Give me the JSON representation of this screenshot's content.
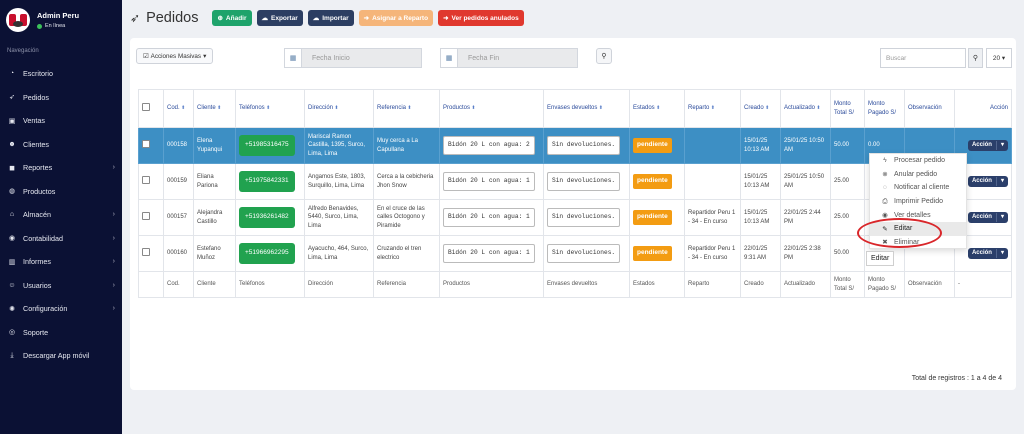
{
  "sidebar": {
    "user": "Admin Peru",
    "status": "En línea",
    "section_title": "Navegación",
    "items": [
      {
        "label": "Escritorio",
        "icon": "speedometer-icon",
        "glyph": "◔",
        "chevron": false
      },
      {
        "label": "Pedidos",
        "icon": "rocket-icon",
        "glyph": "➶",
        "chevron": false
      },
      {
        "label": "Ventas",
        "icon": "cart-icon",
        "glyph": "▣",
        "chevron": false
      },
      {
        "label": "Clientes",
        "icon": "users-icon",
        "glyph": "☻",
        "chevron": false
      },
      {
        "label": "Reportes",
        "icon": "truck-icon",
        "glyph": "◼",
        "chevron": true
      },
      {
        "label": "Productos",
        "icon": "box-icon",
        "glyph": "◍",
        "chevron": false
      },
      {
        "label": "Almacén",
        "icon": "warehouse-icon",
        "glyph": "⌂",
        "chevron": true
      },
      {
        "label": "Contabilidad",
        "icon": "coins-icon",
        "glyph": "◉",
        "chevron": true
      },
      {
        "label": "Informes",
        "icon": "chart-icon",
        "glyph": "▥",
        "chevron": true
      },
      {
        "label": "Usuarios",
        "icon": "user-icon",
        "glyph": "☺",
        "chevron": true
      },
      {
        "label": "Configuración",
        "icon": "gear-icon",
        "glyph": "✺",
        "chevron": true
      },
      {
        "label": "Soporte",
        "icon": "support-icon",
        "glyph": "◎",
        "chevron": false
      },
      {
        "label": "Descargar App móvil",
        "icon": "download-icon",
        "glyph": "⤓",
        "chevron": false
      }
    ]
  },
  "header": {
    "title": "Pedidos",
    "buttons": [
      {
        "label": "Añadir",
        "glyph": "⊕",
        "icon": "plus-icon",
        "color": "green"
      },
      {
        "label": "Exportar",
        "glyph": "☁",
        "icon": "cloud-download-icon",
        "color": "navy"
      },
      {
        "label": "Importar",
        "glyph": "☁",
        "icon": "cloud-upload-icon",
        "color": "navy"
      },
      {
        "label": "Asignar a Reparto",
        "glyph": "➜",
        "icon": "assign-icon",
        "color": "orange"
      },
      {
        "label": "Ver pedidos anulados",
        "glyph": "➜",
        "icon": "arrow-icon",
        "color": "red"
      }
    ]
  },
  "filters": {
    "mass_actions": "Acciones Masivas",
    "date_start_placeholder": "Fecha Inicio",
    "date_end_placeholder": "Fecha Fin",
    "search_placeholder": "Buscar",
    "per_page": "20"
  },
  "table": {
    "headers": [
      "",
      "Cod.",
      "Cliente",
      "Teléfonos",
      "Dirección",
      "Referencia",
      "Productos",
      "Envases devueltos",
      "Estados",
      "Reparto",
      "Creado",
      "Actualizado",
      "Monto Total S/",
      "Monto Pagado S/",
      "Observación",
      "Acción"
    ],
    "rows": [
      {
        "cod": "000158",
        "cliente": "Elena Yupanqui",
        "telefono": "+51985316475",
        "direccion": "Mariscal Ramon Castilla, 1395, Surco, Lima, Lima",
        "referencia": "Muy cerca a La Capullana",
        "producto": "Bidón 20 L con agua: 2",
        "envases": "Sin devoluciones.",
        "estado": "pendiente",
        "reparto": "",
        "creado": "15/01/25 10:13 AM",
        "actualizado": "25/01/25 10:50 AM",
        "total": "50.00",
        "pagado": "0.00",
        "observacion": "",
        "accion": "Acción",
        "selected": true
      },
      {
        "cod": "000159",
        "cliente": "Eliana Pariona",
        "telefono": "+51975842331",
        "direccion": "Angamos Este, 1803, Surquillo, Lima, Lima",
        "referencia": "Cerca a la cebicheria Jhon Snow",
        "producto": "Bidón 20 L con agua: 1",
        "envases": "Sin devoluciones.",
        "estado": "pendiente",
        "reparto": "",
        "creado": "15/01/25 10:13 AM",
        "actualizado": "25/01/25 10:50 AM",
        "total": "25.00",
        "pagado": "",
        "observacion": "",
        "accion": "Acción",
        "selected": false
      },
      {
        "cod": "000157",
        "cliente": "Alejandra Castillo",
        "telefono": "+51936261482",
        "direccion": "Alfredo Benavides, 5440, Surco, Lima, Lima",
        "referencia": "En el cruce de las calles Octogono y Piramide",
        "producto": "Bidón 20 L con agua: 1",
        "envases": "Sin devoluciones.",
        "estado": "pendiente",
        "reparto": "Repartidor Peru 1 - 34 - En curso",
        "creado": "15/01/25 10:13 AM",
        "actualizado": "22/01/25 2:44 PM",
        "total": "25.00",
        "pagado": "",
        "observacion": "",
        "accion": "Acción",
        "selected": false
      },
      {
        "cod": "000160",
        "cliente": "Estefano Muñoz",
        "telefono": "+51966962295",
        "direccion": "Ayacucho, 464, Surco, Lima, Lima",
        "referencia": "Cruzando el tren electrico",
        "producto": "Bidón 20 L con agua: 1",
        "envases": "Sin devoluciones.",
        "estado": "pendiente",
        "reparto": "Repartidor Peru 1 - 34 - En curso",
        "creado": "22/01/25 9:31 AM",
        "actualizado": "22/01/25 2:38 PM",
        "total": "50.00",
        "pagado": "",
        "observacion": "",
        "accion": "Acción",
        "selected": false
      }
    ],
    "footer": [
      "",
      "Cod.",
      "Cliente",
      "Teléfonos",
      "Dirección",
      "Referencia",
      "Productos",
      "Envases devueltos",
      "Estados",
      "Reparto",
      "Creado",
      "Actualizado",
      "Monto Total S/",
      "Monto Pagado S/",
      "Observación",
      "-"
    ]
  },
  "dropdown": {
    "items": [
      {
        "label": "Procesar pedido",
        "glyph": "ϟ",
        "icon": "bolt-icon"
      },
      {
        "label": "Anular pedido",
        "glyph": "⊗",
        "icon": "cancel-icon"
      },
      {
        "label": "Notificar al cliente",
        "glyph": "◌",
        "icon": "whatsapp-icon"
      },
      {
        "label": "Imprimir Pedido",
        "glyph": "⎙",
        "icon": "print-icon"
      },
      {
        "label": "Ver detalles",
        "glyph": "◉",
        "icon": "eye-icon"
      },
      {
        "label": "Editar",
        "glyph": "✎",
        "icon": "pencil-icon",
        "hover": true
      },
      {
        "label": "Eliminar",
        "glyph": "✖",
        "icon": "trash-icon"
      }
    ],
    "tooltip": "Editar"
  },
  "total_text": "Total de registros : 1 a 4 de 4"
}
